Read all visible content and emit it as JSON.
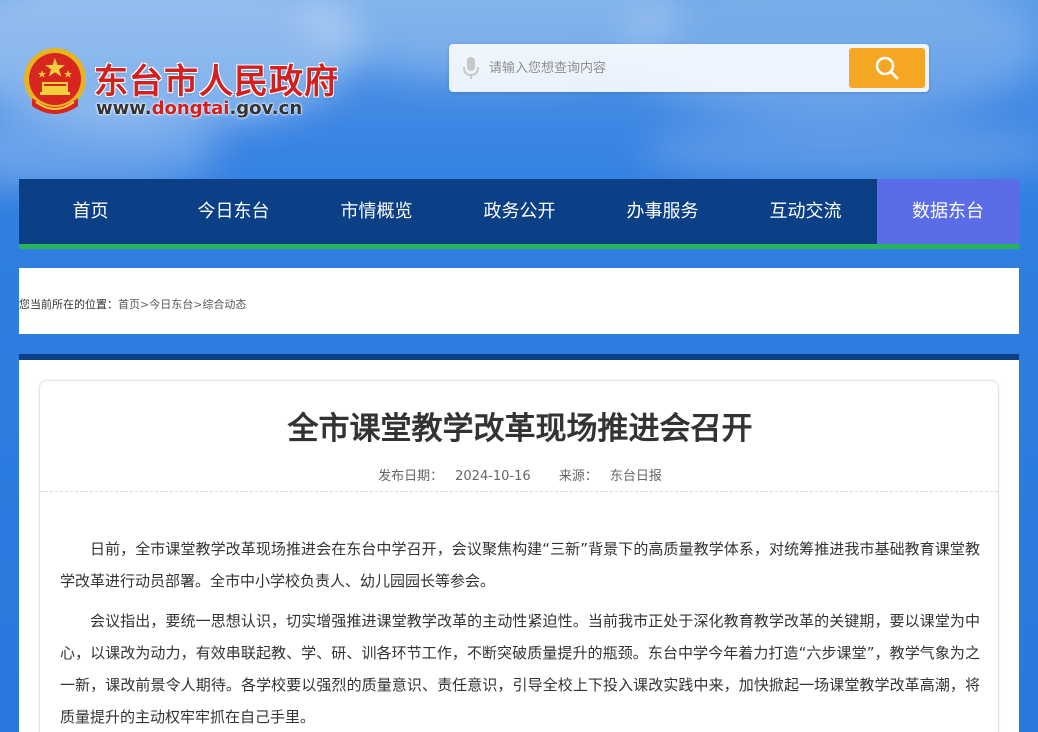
{
  "header": {
    "site_name": "东台市人民政府",
    "url_prefix": "www.",
    "url_highlight": "dongtai",
    "url_suffix": ".gov.cn",
    "search": {
      "placeholder": "请输入您想查询内容",
      "button_icon": "search-icon",
      "mic_icon": "microphone-icon"
    },
    "brand_color": "#d21f1f",
    "search_button_color": "#f5a623"
  },
  "nav": {
    "items": [
      {
        "label": "首页"
      },
      {
        "label": "今日东台"
      },
      {
        "label": "市情概览"
      },
      {
        "label": "政务公开"
      },
      {
        "label": "办事服务"
      },
      {
        "label": "互动交流"
      },
      {
        "label": "数据东台"
      }
    ],
    "active_index": 6,
    "bg_color": "#0b3f86",
    "active_color": "#5b6de6",
    "underline_color": "#27b55b"
  },
  "breadcrumb": {
    "prefix": "您当前所在的位置：",
    "items": [
      "首页",
      "今日东台",
      "综合动态"
    ],
    "separator": ">"
  },
  "article": {
    "title": "全市课堂教学改革现场推进会召开",
    "date_label": "发布日期：",
    "date": "2024-10-16",
    "source_label": "来源：",
    "source": "东台日报",
    "paragraphs": [
      "日前，全市课堂教学改革现场推进会在东台中学召开，会议聚焦构建“三新”背景下的高质量教学体系，对统筹推进我市基础教育课堂教学改革进行动员部署。全市中小学校负责人、幼儿园园长等参会。",
      "会议指出，要统一思想认识，切实增强推进课堂教学改革的主动性紧迫性。当前我市正处于深化教育教学改革的关键期，要以课堂为中心，以课改为动力，有效串联起教、学、研、训各环节工作，不断突破质量提升的瓶颈。东台中学今年着力打造“六步课堂”，教学气象为之一新，课改前景令人期待。各学校要以强烈的质量意识、责任意识，引导全校上下投入课改实践中来，加快掀起一场课堂教学改革高潮，将质量提升的主动权牢牢抓在自己手里。"
    ]
  }
}
